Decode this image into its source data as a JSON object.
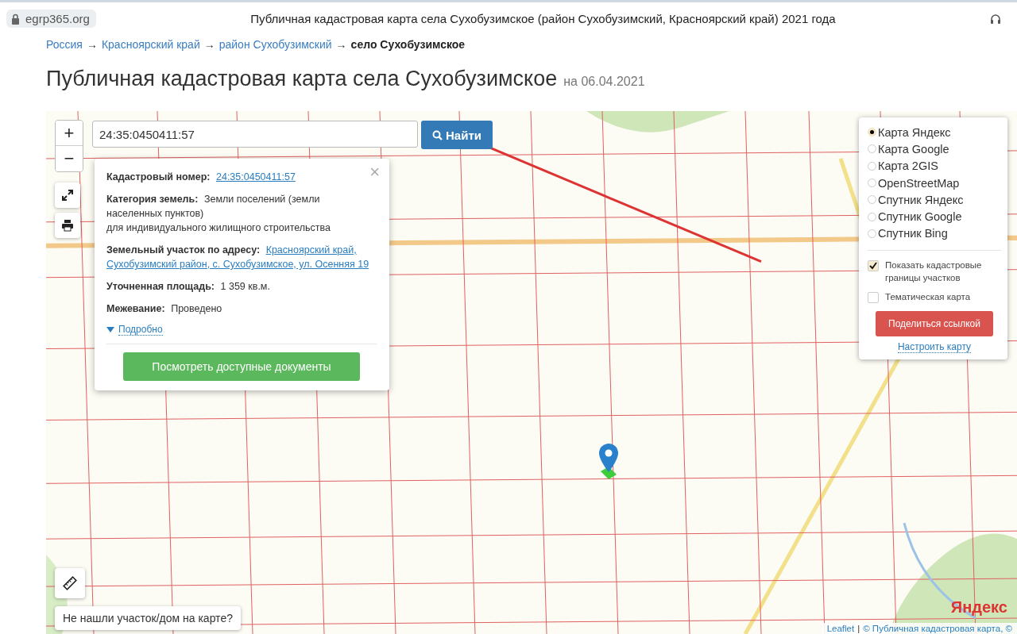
{
  "browser": {
    "url": "egrp365.org",
    "title": "Публичная кадастровая карта села Сухобузимское (район Сухобузимский, Красноярский край) 2021 года"
  },
  "breadcrumbs": [
    {
      "label": "Россия",
      "kind": "link"
    },
    {
      "label": "Красноярский край",
      "kind": "link"
    },
    {
      "label": "район Сухобузимский",
      "kind": "link"
    },
    {
      "label": "село Сухобузимское",
      "kind": "current"
    }
  ],
  "breadcrumb_separator": "→",
  "heading": {
    "title": "Публичная кадастровая карта села Сухобузимское",
    "date": "на 06.04.2021"
  },
  "map": {
    "zoom_controls": [
      "+",
      "−"
    ],
    "search": {
      "value": "24:35:0450411:57",
      "button": "Найти"
    },
    "popup": {
      "close": "×",
      "fields": [
        {
          "label": "Кадастровый номер:",
          "kind": "link",
          "lines": [
            "24:35:0450411:57"
          ]
        },
        {
          "label": "Категория земель:",
          "kind": "text",
          "lines": [
            "Земли поселений (земли",
            "населенных пунктов)",
            "для индивидуального жилищного строительства"
          ]
        },
        {
          "label": "Земельный участок по адресу:",
          "kind": "link",
          "lines": [
            "Красноярский край,",
            "Сухобузимский район, с. Сухобузимское, ул. Осенняя 19"
          ]
        },
        {
          "label": "Уточненная площадь:",
          "kind": "text",
          "lines": [
            "1 359 кв.м."
          ]
        },
        {
          "label": "Межевание:",
          "kind": "text",
          "lines": [
            "Проведено"
          ]
        }
      ],
      "more_link": {
        "label": "Подробно",
        "expanded": false
      },
      "button": "Посмотреть доступные документы"
    },
    "layers": [
      {
        "label": "Карта Яндекс",
        "selected": true
      },
      {
        "label": "Карта Google",
        "selected": false
      },
      {
        "label": "Карта 2GIS",
        "selected": false
      },
      {
        "label": "OpenStreetMap",
        "selected": false
      },
      {
        "label": "Спутник Яндекс",
        "selected": false
      },
      {
        "label": "Спутник Google",
        "selected": false
      },
      {
        "label": "Спутник Bing",
        "selected": false
      }
    ],
    "overlays": [
      {
        "label": "Показать кадастровые границы участков",
        "checked": true
      },
      {
        "label": "Тематическая карта",
        "checked": false
      }
    ],
    "share_button": "Поделиться ссылкой",
    "settings_link": "Настроить карту",
    "not_found_button": "Не нашли участок/дом на карте?",
    "logo": "Яндекс",
    "attribution": {
      "leaflet": "Leaflet",
      "separator": "|",
      "source": "© Публичная кадастровая карта, ©"
    }
  }
}
